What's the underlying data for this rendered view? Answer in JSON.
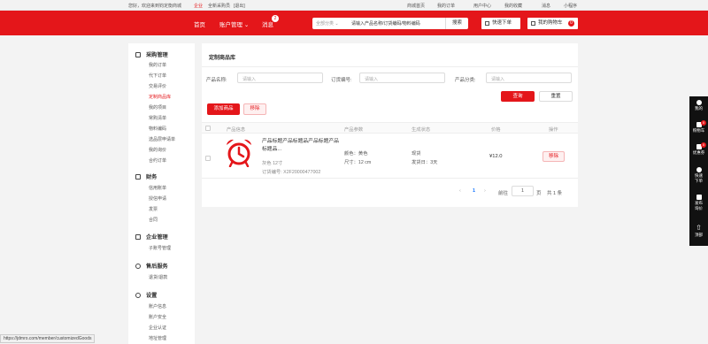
{
  "topbar": {
    "welcome": "您好，欢迎来到钧定衡商城",
    "enterprise": "企业",
    "join": "全新采购员",
    "logout": "[退出]",
    "links": [
      "商城首页",
      "我的订单",
      "用户中心",
      "我的收藏",
      "消息",
      "小程序"
    ]
  },
  "header": {
    "nav": [
      "首页",
      "账户管理",
      "消息"
    ],
    "message_count": "2",
    "search": {
      "category": "全部分类",
      "placeholder": "请输入产品名称/订货编码/物料编码",
      "button": "搜索"
    },
    "quick_order": "快速下单",
    "cart_label": "我的购物车",
    "cart_count": "0"
  },
  "sidebar": {
    "sections": [
      {
        "title": "采购管理",
        "icon": "cart-icon",
        "items": [
          "我的订单",
          "代下订单",
          "交易评价",
          "定制商品库",
          "我的项目",
          "常购清单",
          "物料编码",
          "选品层申请单",
          "我的询价",
          "合约订单"
        ]
      },
      {
        "title": "财务",
        "icon": "wallet-icon",
        "items": [
          "信用账单",
          "授信申请",
          "发票",
          "合同"
        ]
      },
      {
        "title": "企业管理",
        "icon": "building-icon",
        "items": [
          "子账号管理"
        ]
      },
      {
        "title": "售后服务",
        "icon": "shield-icon",
        "items": [
          "退货/退款"
        ]
      },
      {
        "title": "设置",
        "icon": "gear-icon",
        "items": [
          "账户信息",
          "账户安全",
          "企业认证",
          "地址管理"
        ]
      }
    ],
    "active_item": "定制商品库"
  },
  "main": {
    "title": "定制商品库",
    "filters": [
      {
        "label": "产品名称:",
        "placeholder": "请输入"
      },
      {
        "label": "订货编号:",
        "placeholder": "请输入"
      },
      {
        "label": "产品分类:",
        "placeholder": "请输入"
      }
    ],
    "query_btn": "查询",
    "reset_btn": "重置",
    "add_btn": "添加商品",
    "remove_btn": "移除",
    "table": {
      "headers": [
        "产品信息",
        "产品参数",
        "生成状态",
        "价格",
        "操作"
      ],
      "rows": [
        {
          "name": "产品标题产品标题品产品标题产品标题品...",
          "spec": "灰色 12寸",
          "order_no_label": "订货编号:",
          "order_no": "X2F20000477002",
          "param_color": "颜色：黄色",
          "param_size": "尺寸：12 cm",
          "status": "现货",
          "ship": "发货日：3天",
          "price": "¥12.0",
          "action": "移除"
        }
      ]
    },
    "pagination": {
      "current": "1",
      "goto_label": "前往",
      "goto_value": "1",
      "page_unit": "页",
      "total": "共 1 条"
    }
  },
  "rightbar": {
    "items": [
      "我的",
      "购物车",
      "优惠券",
      "快速下单",
      "发布询价"
    ],
    "cart_badge": "0",
    "coupon_badge": "0",
    "top": "顶部"
  },
  "status_url": "https://jdmro.com/member/customizedGoods",
  "colors": {
    "brand": "#e4161a"
  }
}
